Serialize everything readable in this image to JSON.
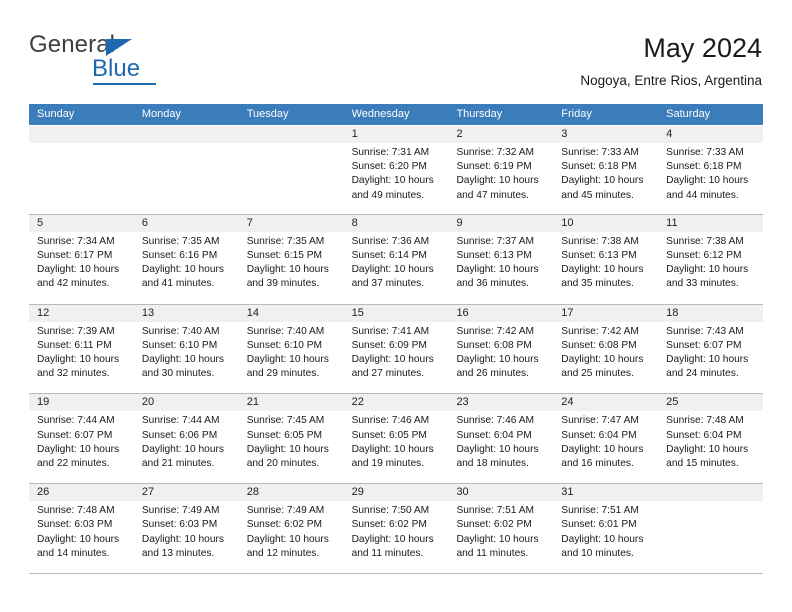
{
  "brand": {
    "name_top": "General",
    "name_bottom": "Blue",
    "accent_color": "#1f68b0"
  },
  "header": {
    "title": "May 2024",
    "subtitle": "Nogoya, Entre Rios, Argentina"
  },
  "calendar": {
    "header_bg_color": "#3b7cba",
    "daynum_bg_color": "#f0f0f0",
    "weekdays": [
      "Sunday",
      "Monday",
      "Tuesday",
      "Wednesday",
      "Thursday",
      "Friday",
      "Saturday"
    ],
    "weeks": [
      [
        {
          "day": "",
          "sunrise": "",
          "sunset": "",
          "daylight": "",
          "empty": true
        },
        {
          "day": "",
          "sunrise": "",
          "sunset": "",
          "daylight": "",
          "empty": true
        },
        {
          "day": "",
          "sunrise": "",
          "sunset": "",
          "daylight": "",
          "empty": true
        },
        {
          "day": "1",
          "sunrise": "Sunrise: 7:31 AM",
          "sunset": "Sunset: 6:20 PM",
          "daylight": "Daylight: 10 hours and 49 minutes."
        },
        {
          "day": "2",
          "sunrise": "Sunrise: 7:32 AM",
          "sunset": "Sunset: 6:19 PM",
          "daylight": "Daylight: 10 hours and 47 minutes."
        },
        {
          "day": "3",
          "sunrise": "Sunrise: 7:33 AM",
          "sunset": "Sunset: 6:18 PM",
          "daylight": "Daylight: 10 hours and 45 minutes."
        },
        {
          "day": "4",
          "sunrise": "Sunrise: 7:33 AM",
          "sunset": "Sunset: 6:18 PM",
          "daylight": "Daylight: 10 hours and 44 minutes."
        }
      ],
      [
        {
          "day": "5",
          "sunrise": "Sunrise: 7:34 AM",
          "sunset": "Sunset: 6:17 PM",
          "daylight": "Daylight: 10 hours and 42 minutes."
        },
        {
          "day": "6",
          "sunrise": "Sunrise: 7:35 AM",
          "sunset": "Sunset: 6:16 PM",
          "daylight": "Daylight: 10 hours and 41 minutes."
        },
        {
          "day": "7",
          "sunrise": "Sunrise: 7:35 AM",
          "sunset": "Sunset: 6:15 PM",
          "daylight": "Daylight: 10 hours and 39 minutes."
        },
        {
          "day": "8",
          "sunrise": "Sunrise: 7:36 AM",
          "sunset": "Sunset: 6:14 PM",
          "daylight": "Daylight: 10 hours and 37 minutes."
        },
        {
          "day": "9",
          "sunrise": "Sunrise: 7:37 AM",
          "sunset": "Sunset: 6:13 PM",
          "daylight": "Daylight: 10 hours and 36 minutes."
        },
        {
          "day": "10",
          "sunrise": "Sunrise: 7:38 AM",
          "sunset": "Sunset: 6:13 PM",
          "daylight": "Daylight: 10 hours and 35 minutes."
        },
        {
          "day": "11",
          "sunrise": "Sunrise: 7:38 AM",
          "sunset": "Sunset: 6:12 PM",
          "daylight": "Daylight: 10 hours and 33 minutes."
        }
      ],
      [
        {
          "day": "12",
          "sunrise": "Sunrise: 7:39 AM",
          "sunset": "Sunset: 6:11 PM",
          "daylight": "Daylight: 10 hours and 32 minutes."
        },
        {
          "day": "13",
          "sunrise": "Sunrise: 7:40 AM",
          "sunset": "Sunset: 6:10 PM",
          "daylight": "Daylight: 10 hours and 30 minutes."
        },
        {
          "day": "14",
          "sunrise": "Sunrise: 7:40 AM",
          "sunset": "Sunset: 6:10 PM",
          "daylight": "Daylight: 10 hours and 29 minutes."
        },
        {
          "day": "15",
          "sunrise": "Sunrise: 7:41 AM",
          "sunset": "Sunset: 6:09 PM",
          "daylight": "Daylight: 10 hours and 27 minutes."
        },
        {
          "day": "16",
          "sunrise": "Sunrise: 7:42 AM",
          "sunset": "Sunset: 6:08 PM",
          "daylight": "Daylight: 10 hours and 26 minutes."
        },
        {
          "day": "17",
          "sunrise": "Sunrise: 7:42 AM",
          "sunset": "Sunset: 6:08 PM",
          "daylight": "Daylight: 10 hours and 25 minutes."
        },
        {
          "day": "18",
          "sunrise": "Sunrise: 7:43 AM",
          "sunset": "Sunset: 6:07 PM",
          "daylight": "Daylight: 10 hours and 24 minutes."
        }
      ],
      [
        {
          "day": "19",
          "sunrise": "Sunrise: 7:44 AM",
          "sunset": "Sunset: 6:07 PM",
          "daylight": "Daylight: 10 hours and 22 minutes."
        },
        {
          "day": "20",
          "sunrise": "Sunrise: 7:44 AM",
          "sunset": "Sunset: 6:06 PM",
          "daylight": "Daylight: 10 hours and 21 minutes."
        },
        {
          "day": "21",
          "sunrise": "Sunrise: 7:45 AM",
          "sunset": "Sunset: 6:05 PM",
          "daylight": "Daylight: 10 hours and 20 minutes."
        },
        {
          "day": "22",
          "sunrise": "Sunrise: 7:46 AM",
          "sunset": "Sunset: 6:05 PM",
          "daylight": "Daylight: 10 hours and 19 minutes."
        },
        {
          "day": "23",
          "sunrise": "Sunrise: 7:46 AM",
          "sunset": "Sunset: 6:04 PM",
          "daylight": "Daylight: 10 hours and 18 minutes."
        },
        {
          "day": "24",
          "sunrise": "Sunrise: 7:47 AM",
          "sunset": "Sunset: 6:04 PM",
          "daylight": "Daylight: 10 hours and 16 minutes."
        },
        {
          "day": "25",
          "sunrise": "Sunrise: 7:48 AM",
          "sunset": "Sunset: 6:04 PM",
          "daylight": "Daylight: 10 hours and 15 minutes."
        }
      ],
      [
        {
          "day": "26",
          "sunrise": "Sunrise: 7:48 AM",
          "sunset": "Sunset: 6:03 PM",
          "daylight": "Daylight: 10 hours and 14 minutes."
        },
        {
          "day": "27",
          "sunrise": "Sunrise: 7:49 AM",
          "sunset": "Sunset: 6:03 PM",
          "daylight": "Daylight: 10 hours and 13 minutes."
        },
        {
          "day": "28",
          "sunrise": "Sunrise: 7:49 AM",
          "sunset": "Sunset: 6:02 PM",
          "daylight": "Daylight: 10 hours and 12 minutes."
        },
        {
          "day": "29",
          "sunrise": "Sunrise: 7:50 AM",
          "sunset": "Sunset: 6:02 PM",
          "daylight": "Daylight: 10 hours and 11 minutes."
        },
        {
          "day": "30",
          "sunrise": "Sunrise: 7:51 AM",
          "sunset": "Sunset: 6:02 PM",
          "daylight": "Daylight: 10 hours and 11 minutes."
        },
        {
          "day": "31",
          "sunrise": "Sunrise: 7:51 AM",
          "sunset": "Sunset: 6:01 PM",
          "daylight": "Daylight: 10 hours and 10 minutes."
        },
        {
          "day": "",
          "sunrise": "",
          "sunset": "",
          "daylight": "",
          "empty": true
        }
      ]
    ]
  }
}
